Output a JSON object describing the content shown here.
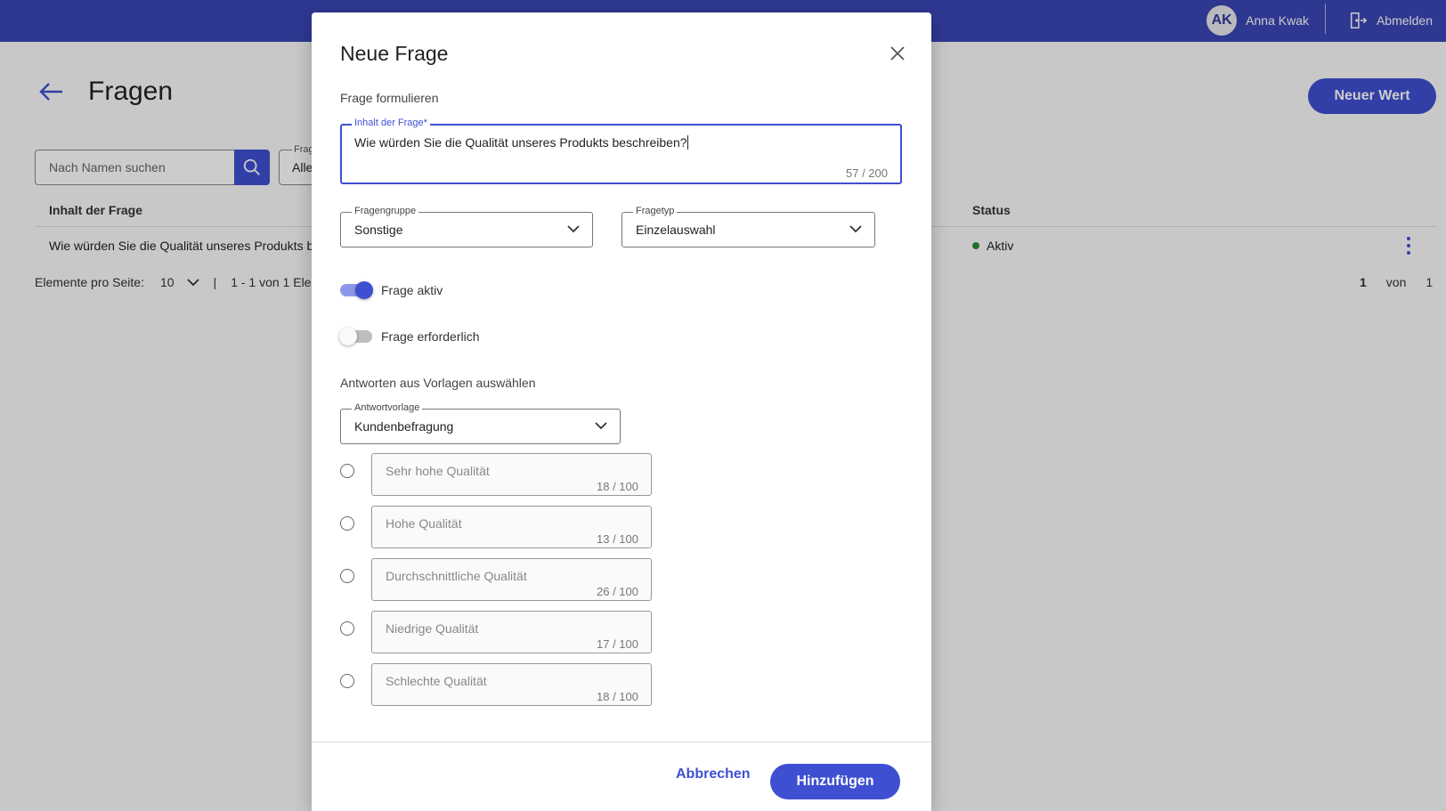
{
  "topbar": {
    "user_initials": "AK",
    "user_name": "Anna Kwak",
    "logout_label": "Abmelden",
    "color": "#3a46b6"
  },
  "page": {
    "title": "Fragen",
    "new_value_label": "Neuer Wert",
    "search_placeholder": "Nach Namen suchen",
    "filter_label": "Frag",
    "filter_value": "Alle",
    "table": {
      "headers": [
        "Inhalt der Frage",
        "Status"
      ],
      "rows": [
        {
          "question": "Wie würden Sie die Qualität unseres Produkts be",
          "status": "Aktiv"
        }
      ]
    },
    "paginator": {
      "items_per_page_label": "Elemente pro Seite:",
      "items_per_page": "10",
      "separator": "|",
      "range": "1 - 1 von 1 Elem",
      "current_page": "1",
      "of_label": "von",
      "total_pages": "1"
    }
  },
  "dialog": {
    "title": "Neue Frage",
    "section_formulate": "Frage formulieren",
    "question_field": {
      "label": "Inhalt der Frage*",
      "value": "Wie würden Sie die Qualität unseres Produkts beschreiben?",
      "counter": "57 / 200"
    },
    "group_field": {
      "label": "Fragengruppe",
      "value": "Sonstige"
    },
    "type_field": {
      "label": "Fragetyp",
      "value": "Einzelauswahl"
    },
    "toggle_active": {
      "label": "Frage aktiv",
      "on": true
    },
    "toggle_required": {
      "label": "Frage erforderlich",
      "on": false
    },
    "section_answers": "Antworten aus Vorlagen auswählen",
    "template_field": {
      "label": "Antwortvorlage",
      "value": "Kundenbefragung"
    },
    "answers": [
      {
        "text": "Sehr hohe Qualität",
        "counter": "18 / 100"
      },
      {
        "text": "Hohe Qualität",
        "counter": "13 / 100"
      },
      {
        "text": "Durchschnittliche Qualität",
        "counter": "26 / 100"
      },
      {
        "text": "Niedrige Qualität",
        "counter": "17 / 100"
      },
      {
        "text": "Schlechte Qualität",
        "counter": "18 / 100"
      }
    ],
    "cancel_label": "Abbrechen",
    "add_label": "Hinzufügen",
    "accent_color": "#3f4fd1"
  }
}
